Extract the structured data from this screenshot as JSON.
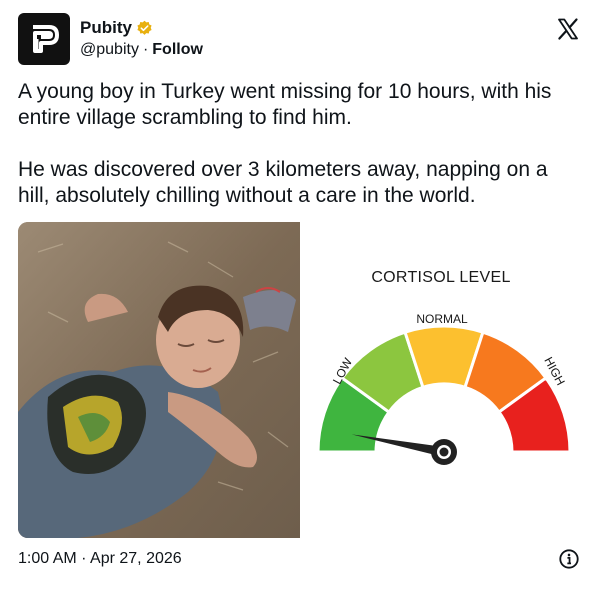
{
  "author": {
    "display_name": "Pubity",
    "handle": "@pubity",
    "separator": "·",
    "follow_label": "Follow",
    "avatar_icon": "pubity-logo-icon",
    "verified_color": "#e8b00f"
  },
  "tweet": {
    "text": "A young boy in Turkey went missing for 10 hours, with his entire village scrambling to find him.\n\nHe was discovered over 3 kilometers away, napping on a hill, absolutely chilling without a care in the world."
  },
  "gauge": {
    "title": "CORTISOL LEVEL",
    "labels": {
      "low": "LOW",
      "normal": "NORMAL",
      "high": "HIGH"
    },
    "level_fraction": 0.06,
    "colors": [
      "#3fb53f",
      "#8cc63f",
      "#fcc02f",
      "#f7791e",
      "#e8211e"
    ]
  },
  "footer": {
    "timestamp": "1:00 AM · Apr 27, 2026",
    "info_icon": "info-icon"
  }
}
